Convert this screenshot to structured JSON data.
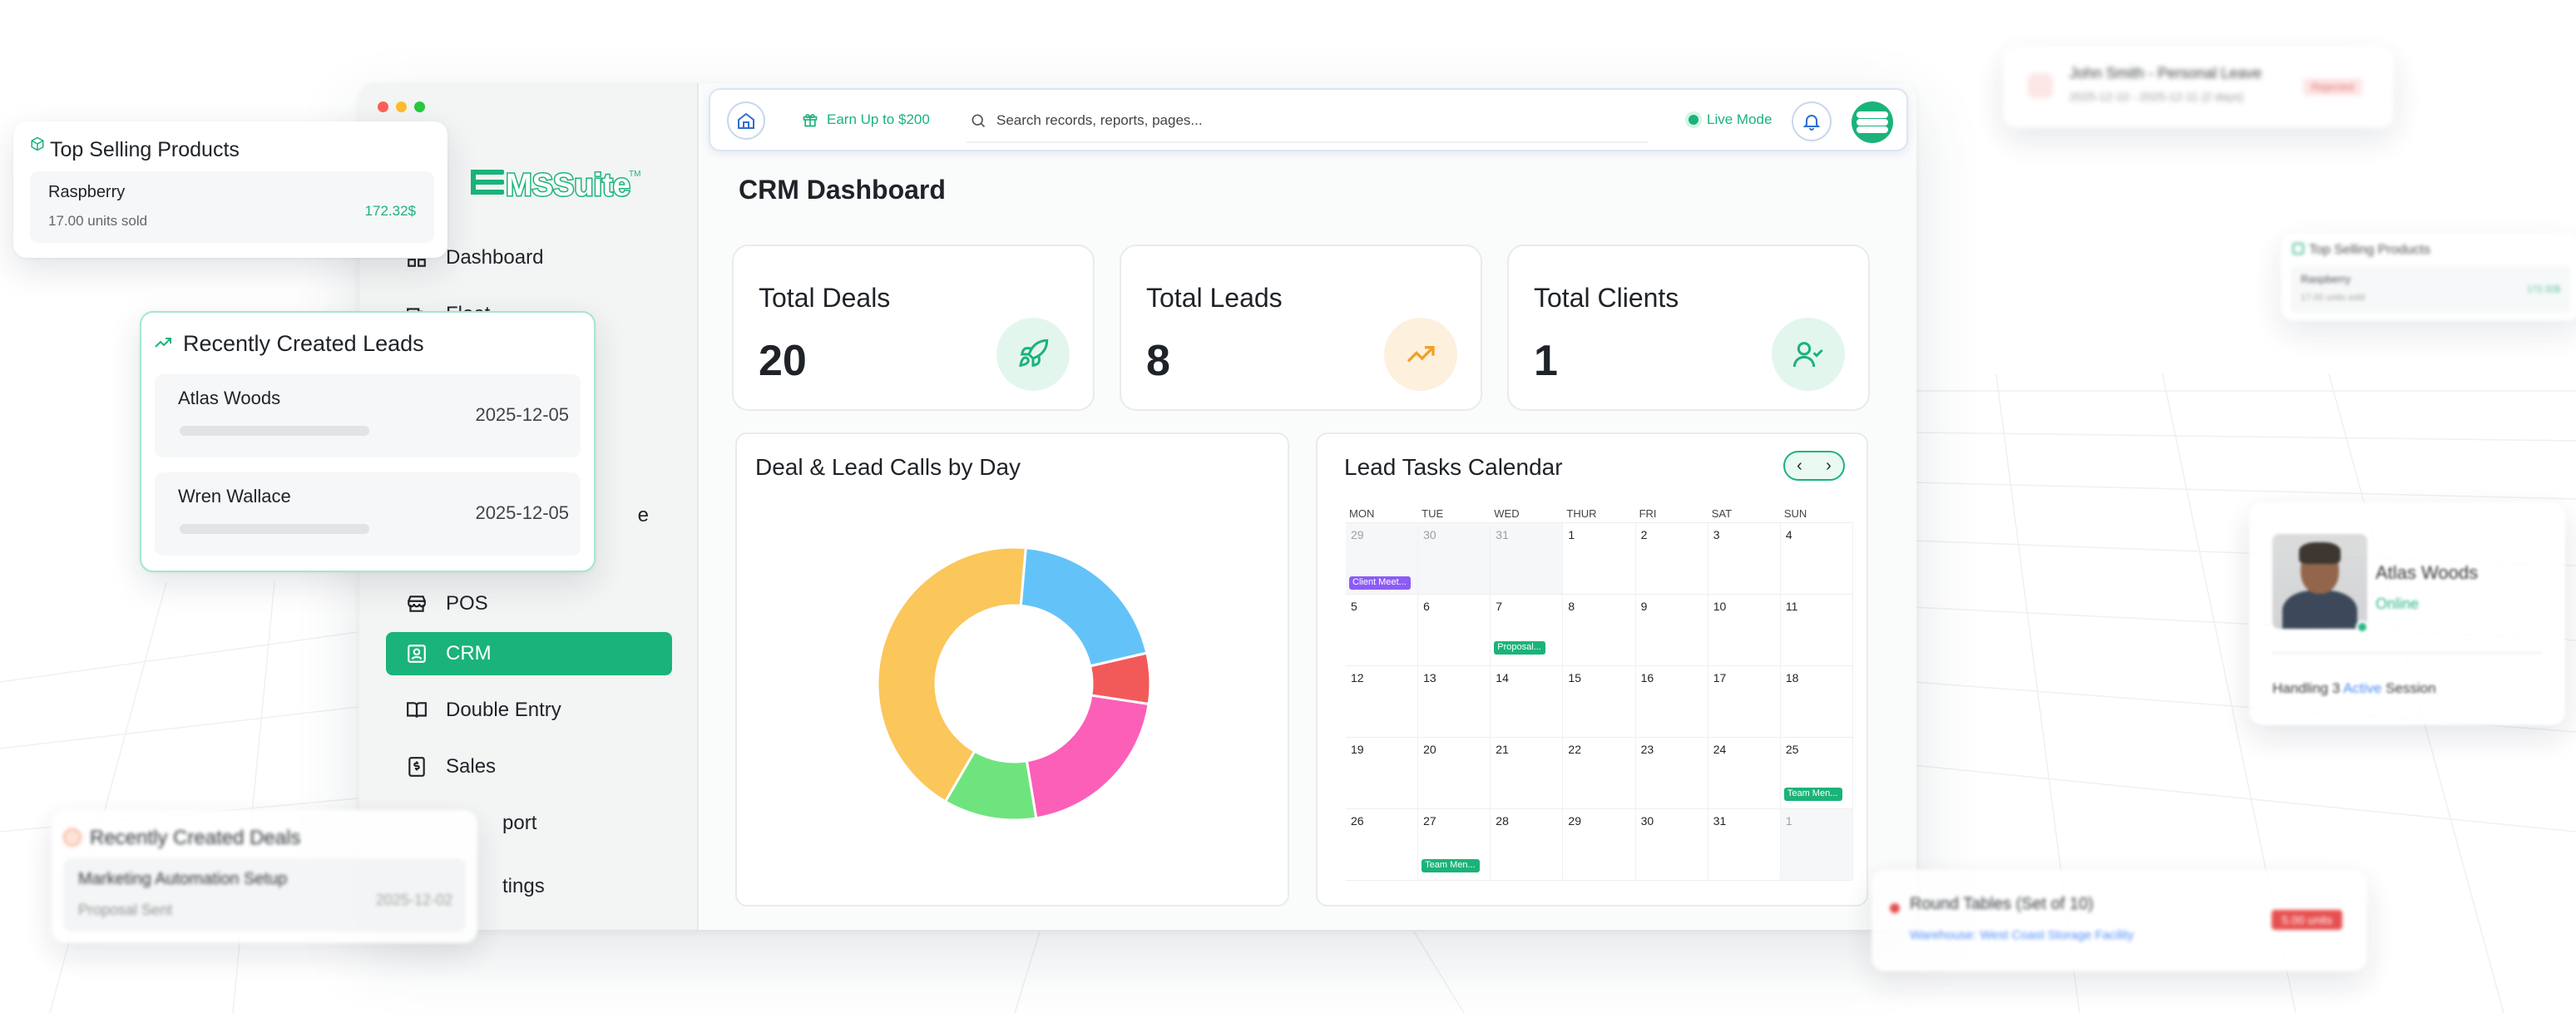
{
  "window": {
    "dot_colors": [
      "#ff5f57",
      "#febc2e",
      "#28c840"
    ]
  },
  "brand": {
    "logo_text": "EMSSuite",
    "accent": "#1ab37a"
  },
  "sidebar": {
    "items": [
      {
        "label": "Dashboard",
        "icon": "grid-icon",
        "visible": "Dashboard"
      },
      {
        "label": "Fleet",
        "icon": "truck-icon",
        "visible": "Fleet"
      },
      {
        "label": "Workspace",
        "icon": "briefcase-icon",
        "visible": "e"
      },
      {
        "label": "POS",
        "icon": "store-icon",
        "visible": "POS"
      },
      {
        "label": "CRM",
        "icon": "contact-icon",
        "visible": "CRM",
        "active": true
      },
      {
        "label": "Double Entry",
        "icon": "book-icon",
        "visible": "Double Entry"
      },
      {
        "label": "Sales",
        "icon": "dollar-file-icon",
        "visible": "Sales"
      },
      {
        "label": "Support",
        "icon": "headset-icon",
        "visible": "port"
      },
      {
        "label": "Settings",
        "icon": "gear-icon",
        "visible": "tings"
      }
    ]
  },
  "topbar": {
    "earn_label": "Earn Up to $200",
    "search_placeholder": "Search records, reports, pages...",
    "live_label": "Live Mode"
  },
  "page": {
    "title": "CRM Dashboard"
  },
  "stats": [
    {
      "label": "Total Deals",
      "value": "20",
      "icon": "rocket-icon",
      "icon_color": "#1ab37a",
      "icon_bg": "#e3f6ee"
    },
    {
      "label": "Total Leads",
      "value": "8",
      "icon": "trending-up-icon",
      "icon_color": "#f0a029",
      "icon_bg": "#fdf0dd"
    },
    {
      "label": "Total Clients",
      "value": "1",
      "icon": "user-check-icon",
      "icon_color": "#1ab37a",
      "icon_bg": "#e3f6ee"
    }
  ],
  "donut": {
    "title": "Deal & Lead Calls by Day"
  },
  "chart_data": {
    "type": "pie",
    "title": "Deal & Lead Calls by Day",
    "slices": [
      {
        "value": 20,
        "color": "#63c3f8"
      },
      {
        "value": 6,
        "color": "#f25a5a"
      },
      {
        "value": 20,
        "color": "#fb5fb8"
      },
      {
        "value": 11,
        "color": "#6fe47e"
      },
      {
        "value": 43,
        "color": "#fbc65a"
      }
    ],
    "start_deg": 5
  },
  "calendar": {
    "title": "Lead Tasks Calendar",
    "weekdays": [
      "MON",
      "TUE",
      "WED",
      "THUR",
      "FRI",
      "SAT",
      "SUN"
    ],
    "days": [
      "29",
      "30",
      "31",
      "1",
      "2",
      "3",
      "4",
      "5",
      "6",
      "7",
      "8",
      "9",
      "10",
      "11",
      "12",
      "13",
      "14",
      "15",
      "16",
      "17",
      "18",
      "19",
      "20",
      "21",
      "22",
      "23",
      "24",
      "25",
      "26",
      "27",
      "28",
      "29",
      "30",
      "31",
      "1"
    ],
    "events": {
      "0": "Client Meet...",
      "9": "Proposal...",
      "27": "Team Men...",
      "29": "Team Men..."
    }
  },
  "cards": {
    "top_selling": {
      "title": "Top Selling Products",
      "item": "Raspberry",
      "units": "17.00 units sold",
      "price": "172.32$"
    },
    "recent_leads": {
      "title": "Recently Created Leads",
      "items": [
        {
          "name": "Atlas Woods",
          "date": "2025-12-05"
        },
        {
          "name": "Wren Wallace",
          "date": "2025-12-05"
        }
      ]
    },
    "recent_deals": {
      "title": "Recently Created Deals",
      "item": "Marketing Automation Setup",
      "status": "Proposal Sent",
      "date": "2025-12-02"
    },
    "leave": {
      "title": "John Smith - Personal Leave",
      "dates": "2025-12-10 - 2025-12-11 (2 days)",
      "badge": "Rejected"
    },
    "top_selling_small": {
      "title": "Top Selling Products",
      "item": "Raspberry",
      "units": "17.00 units sold",
      "price": "172.32$"
    },
    "user": {
      "name": "Atlas Woods",
      "status": "Online",
      "sessions_pre": "Handling 3",
      "sessions_hl": "Active",
      "sessions_post": "Session"
    },
    "round_tables": {
      "title": "Round Tables (Set of 10)",
      "location": "Warehouse: West Coast Storage Facility",
      "badge": "5.00 units"
    }
  }
}
